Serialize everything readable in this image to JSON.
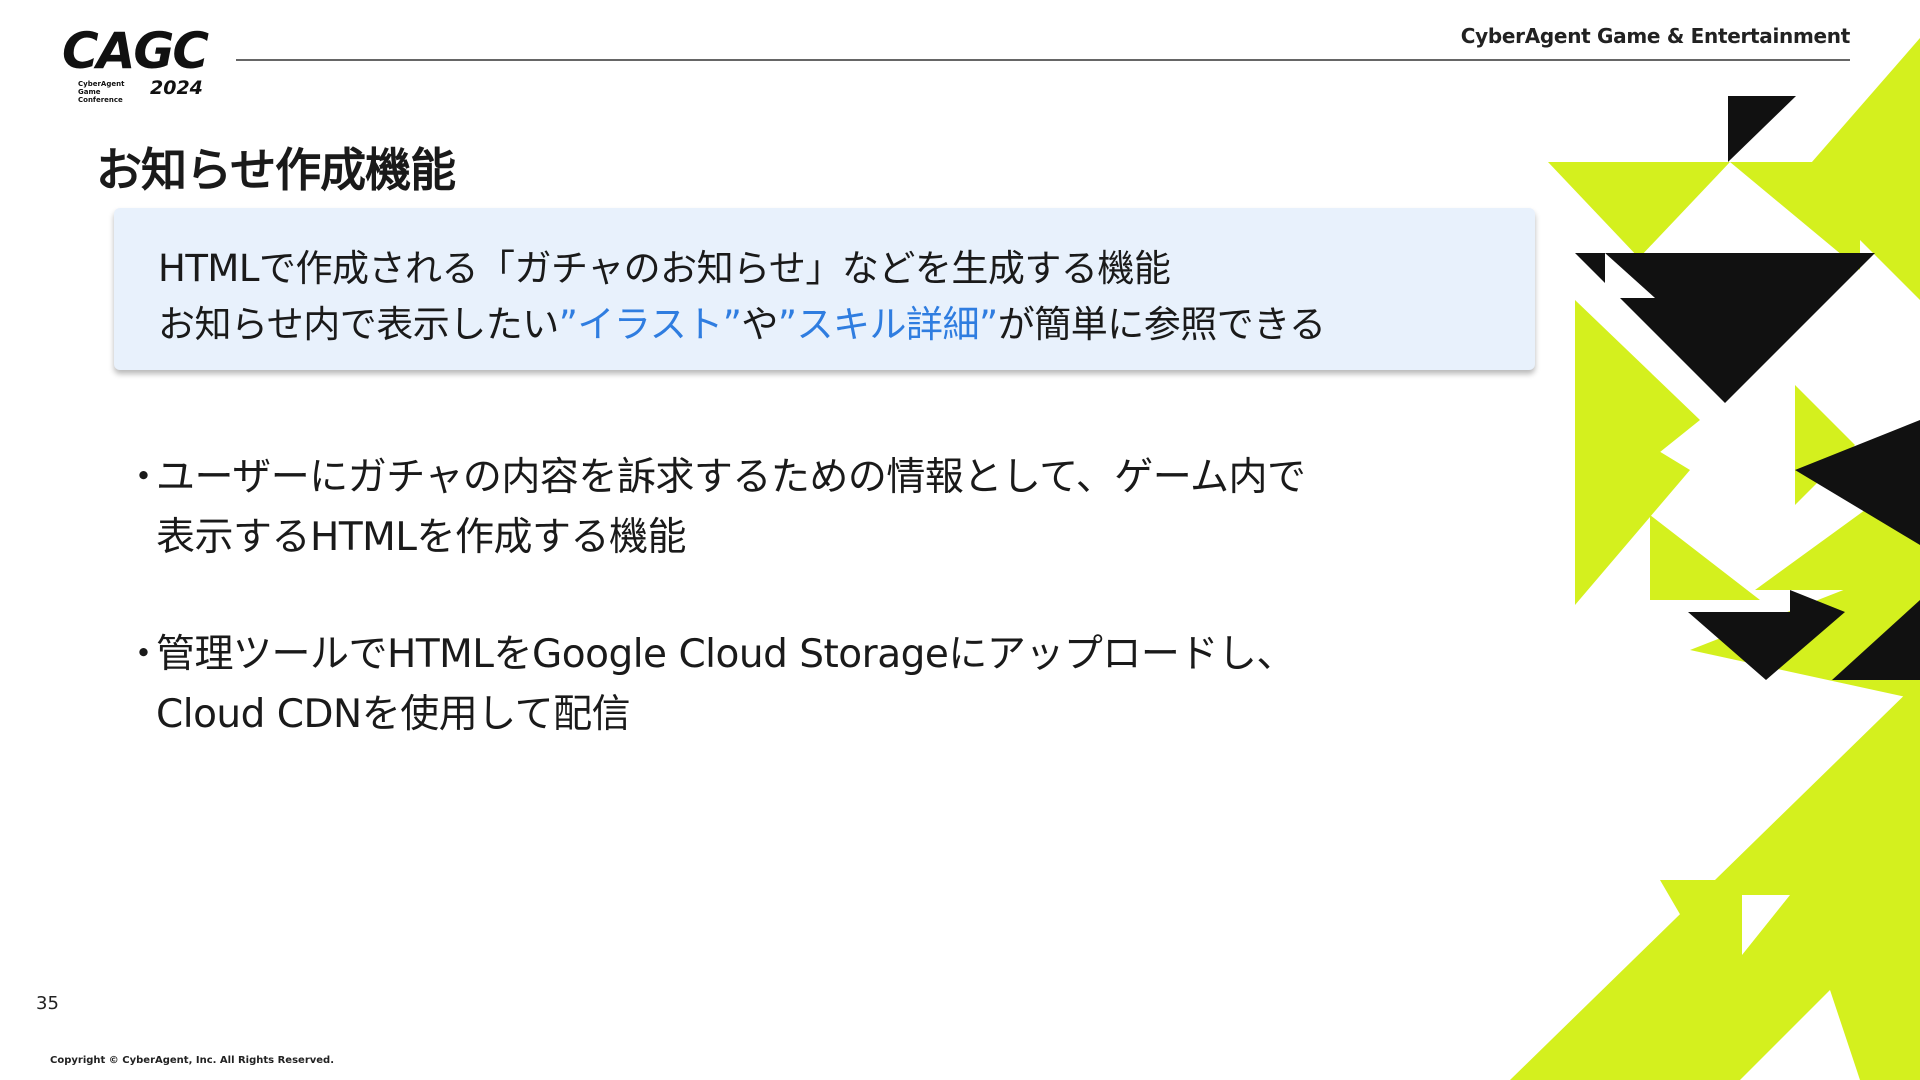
{
  "header": {
    "logo_main": "CAGC",
    "logo_sub": "CyberAgent Game Conference",
    "logo_year": "2024",
    "company": "CyberAgent Game & Entertainment"
  },
  "slide": {
    "title": "お知らせ作成機能",
    "callout": {
      "line1": "HTMLで作成される「ガチャのお知らせ」などを生成する機能",
      "line2_prefix": "お知らせ内で表示したい",
      "line2_hl1": "”イラスト”",
      "line2_mid": "や",
      "line2_hl2": "”スキル詳細”",
      "line2_suffix": "が簡単に参照できる"
    },
    "bullets": [
      {
        "marker": "・",
        "line1": "ユーザーにガチャの内容を訴求するための情報として、ゲーム内で",
        "line2": "表示するHTMLを作成する機能"
      },
      {
        "marker": "・",
        "line1": "管理ツールでHTMLをGoogle Cloud Storageにアップロードし、",
        "line2": "Cloud CDNを使用して配信"
      }
    ]
  },
  "footer": {
    "page_number": "35",
    "copyright": "Copyright © CyberAgent, Inc. All Rights Reserved."
  },
  "colors": {
    "accent_lime": "#d4f01e",
    "highlight_blue": "#2f7de0",
    "callout_bg": "#e8f1fc"
  }
}
